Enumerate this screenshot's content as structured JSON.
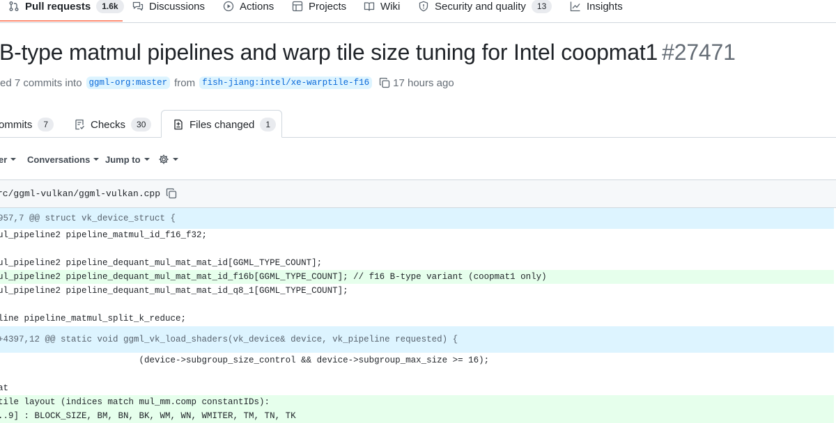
{
  "nav": {
    "pull_requests": "Pull requests",
    "pull_requests_count": "1.6k",
    "discussions": "Discussions",
    "actions": "Actions",
    "projects": "Projects",
    "wiki": "Wiki",
    "security": "Security and quality",
    "security_count": "13",
    "insights": "Insights"
  },
  "pr": {
    "title": "B-type matmul pipelines and warp tile size tuning for Intel coopmat1",
    "number": "#27471",
    "meta_prefix": "ed 7 commits into",
    "base_branch": "ggml-org:master",
    "from": "from",
    "head_branch": "fish-jiang:intel/xe-warptile-f16",
    "time": "17 hours ago"
  },
  "tabs": {
    "commits": "ommits",
    "commits_count": "7",
    "checks": "Checks",
    "checks_count": "30",
    "files": "Files changed",
    "files_count": "1"
  },
  "toolbar": {
    "filter": "er",
    "conversations": "Conversations",
    "jump_to": "Jump to"
  },
  "file": {
    "path": "rc/ggml-vulkan/ggml-vulkan.cpp"
  },
  "diff": {
    "hunk1": "957,7 @@ struct vk_device_struct {",
    "l1": "ul_pipeline2 pipeline_matmul_id_f16_f32;",
    "l2": "",
    "l3": "ul_pipeline2 pipeline_dequant_mul_mat_mat_id[GGML_TYPE_COUNT];",
    "l4": "ul_pipeline2 pipeline_dequant_mul_mat_mat_id_f16b[GGML_TYPE_COUNT]; // f16 B-type variant (coopmat1 only)",
    "l5": "ul_pipeline2 pipeline_dequant_mul_mat_mat_id_q8_1[GGML_TYPE_COUNT];",
    "l6": "",
    "l7": "line pipeline_matmul_split_k_reduce;",
    "hunk2": "+4397,12 @@ static void ggml_vk_load_shaders(vk_device& device, vk_pipeline requested) {",
    "l8": "                           (device->subgroup_size_control && device->subgroup_max_size >= 16);",
    "l9": "",
    "l10": "at",
    "l11": "tile layout (indices match mul_mm.comp constantIDs):",
    "l12": "..9] : BLOCK_SIZE, BM, BN, BK, WM, WN, WMITER, TM, TN, TK"
  },
  "colors": {
    "accent_underline": "#fd8c73",
    "link": "#0969da",
    "hunk_bg": "#ddf4ff",
    "add_bg": "#e6ffec"
  }
}
